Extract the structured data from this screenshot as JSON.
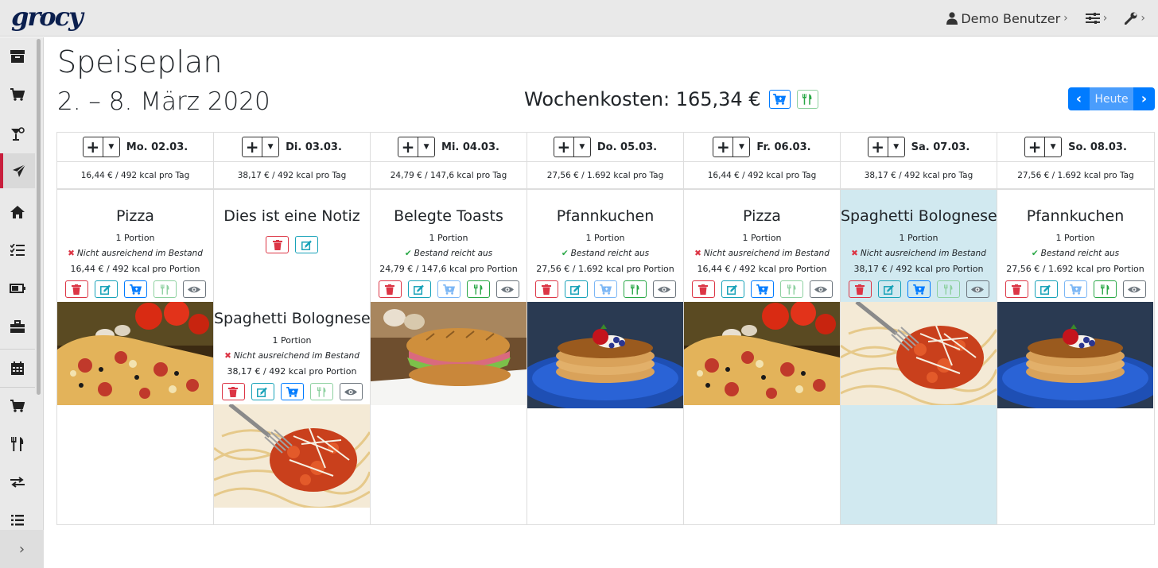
{
  "app": {
    "logo": "grocy"
  },
  "topnav": {
    "user_label": "Demo Benutzer"
  },
  "page": {
    "title": "Speiseplan",
    "date_range": "2. – 8. März 2020",
    "week_costs": "Wochenkosten: 165,34 €",
    "today_label": "Heute"
  },
  "colors": {
    "accent": "#007bff",
    "highlight": "#d1e9f0",
    "danger": "#dc3545",
    "success": "#28a745",
    "active_marker": "#c81e3c"
  },
  "days": [
    {
      "label": "Mo. 02.03.",
      "summary": "16,44 € / 492 kcal pro Tag",
      "meals": [
        {
          "name": "Pizza",
          "portion": "1 Portion",
          "stock": "Nicht ausreichend im Bestand",
          "stock_ok": false,
          "cost": "16,44 € / 492 kcal pro Portion",
          "image": "pizza"
        }
      ]
    },
    {
      "label": "Di. 03.03.",
      "summary": "38,17 € / 492 kcal pro Tag",
      "note": "Dies ist eine Notiz",
      "meals": [
        {
          "name": "Spaghetti Bolognese",
          "portion": "1 Portion",
          "stock": "Nicht ausreichend im Bestand",
          "stock_ok": false,
          "cost": "38,17 € / 492 kcal pro Portion",
          "image": "spaghetti"
        }
      ]
    },
    {
      "label": "Mi. 04.03.",
      "summary": "24,79 € / 147,6 kcal pro Tag",
      "meals": [
        {
          "name": "Belegte Toasts",
          "portion": "1 Portion",
          "stock": "Bestand reicht aus",
          "stock_ok": true,
          "cost": "24,79 € / 147,6 kcal pro Portion",
          "image": "sandwich"
        }
      ]
    },
    {
      "label": "Do. 05.03.",
      "summary": "27,56 € / 1.692 kcal pro Tag",
      "meals": [
        {
          "name": "Pfannkuchen",
          "portion": "1 Portion",
          "stock": "Bestand reicht aus",
          "stock_ok": true,
          "cost": "27,56 € / 1.692 kcal pro Portion",
          "image": "pancakes"
        }
      ]
    },
    {
      "label": "Fr. 06.03.",
      "summary": "16,44 € / 492 kcal pro Tag",
      "meals": [
        {
          "name": "Pizza",
          "portion": "1 Portion",
          "stock": "Nicht ausreichend im Bestand",
          "stock_ok": false,
          "cost": "16,44 € / 492 kcal pro Portion",
          "image": "pizza"
        }
      ]
    },
    {
      "label": "Sa. 07.03.",
      "summary": "38,17 € / 492 kcal pro Tag",
      "today": true,
      "meals": [
        {
          "name": "Spaghetti Bolognese",
          "portion": "1 Portion",
          "stock": "Nicht ausreichend im Bestand",
          "stock_ok": false,
          "cost": "38,17 € / 492 kcal pro Portion",
          "image": "spaghetti"
        }
      ]
    },
    {
      "label": "So. 08.03.",
      "summary": "27,56 € / 1.692 kcal pro Tag",
      "meals": [
        {
          "name": "Pfannkuchen",
          "portion": "1 Portion",
          "stock": "Bestand reicht aus",
          "stock_ok": true,
          "cost": "27,56 € / 1.692 kcal pro Portion",
          "image": "pancakes"
        }
      ]
    }
  ]
}
